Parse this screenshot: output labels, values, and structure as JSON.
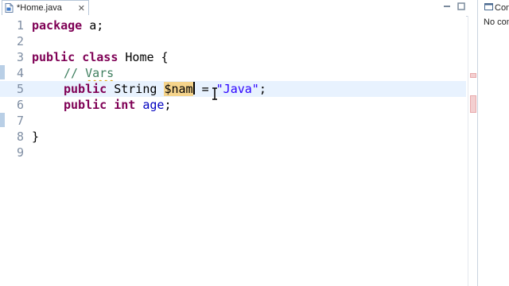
{
  "editor_tab": {
    "label": "*Home.java",
    "close": "✕"
  },
  "side_panel": {
    "tab_label": "Con",
    "message": "No con"
  },
  "lines": [
    {
      "num": "1"
    },
    {
      "num": "2"
    },
    {
      "num": "3"
    },
    {
      "num": "4"
    },
    {
      "num": "5"
    },
    {
      "num": "6"
    },
    {
      "num": "7"
    },
    {
      "num": "8"
    },
    {
      "num": "9"
    }
  ],
  "code": {
    "l1_kw": "package",
    "l1_rest": " a;",
    "l3_kw1": "public",
    "l3_kw2": "class",
    "l3_rest": " Home {",
    "l4_comment_prefix": "// ",
    "l4_comment_word": "Vars",
    "l5_kw": "public",
    "l5_type": " String ",
    "l5_var": "$nam",
    "l5_eq": " = ",
    "l5_str": "\"Java\"",
    "l5_end": ";",
    "l6_kw1": "public",
    "l6_kw2": "int",
    "l6_field": "age",
    "l6_end": ";",
    "l8_brace": "}"
  },
  "colors": {
    "keyword": "#7f0055",
    "comment": "#3f7f5f",
    "string": "#2a00ff",
    "field": "#0000c0",
    "current_line": "#e8f2fe",
    "selection": "#f5d48c"
  },
  "icons": [
    "java-file-icon",
    "close-icon",
    "console-icon",
    "text-cursor-icon"
  ]
}
